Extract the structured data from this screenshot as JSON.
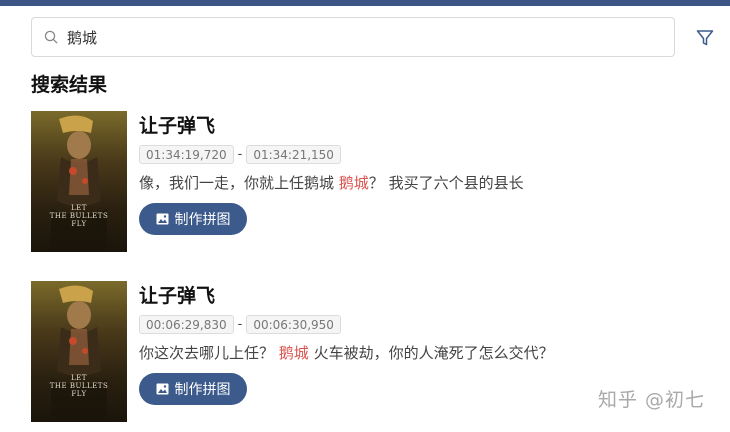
{
  "search": {
    "value": "鹅城",
    "placeholder": ""
  },
  "section_title": "搜索结果",
  "results": [
    {
      "movie_title": "让子弹飞",
      "start_time": "01:34:19,720",
      "end_time": "01:34:21,150",
      "time_separator": "-",
      "line_before": "像，我们一走，你就上任鹅城 ",
      "line_highlight": "鹅城",
      "line_after": "？ 我买了六个县的县长",
      "button_label": "制作拼图",
      "poster_text": "LET\nTHE BULLETS\nFLY"
    },
    {
      "movie_title": "让子弹飞",
      "start_time": "00:06:29,830",
      "end_time": "00:06:30,950",
      "time_separator": "-",
      "line_before": "你这次去哪儿上任？ ",
      "line_highlight": "鹅城",
      "line_after": " 火车被劫，你的人淹死了怎么交代？",
      "button_label": "制作拼图",
      "poster_text": "LET\nTHE BULLETS\nFLY"
    }
  ],
  "watermark": "知乎 @初七",
  "icons": {
    "search": "search-icon",
    "filter": "filter-icon",
    "image": "image-icon"
  },
  "colors": {
    "top_bar": "#3c5585",
    "button": "#3d5a8c",
    "highlight": "#d9534f"
  }
}
